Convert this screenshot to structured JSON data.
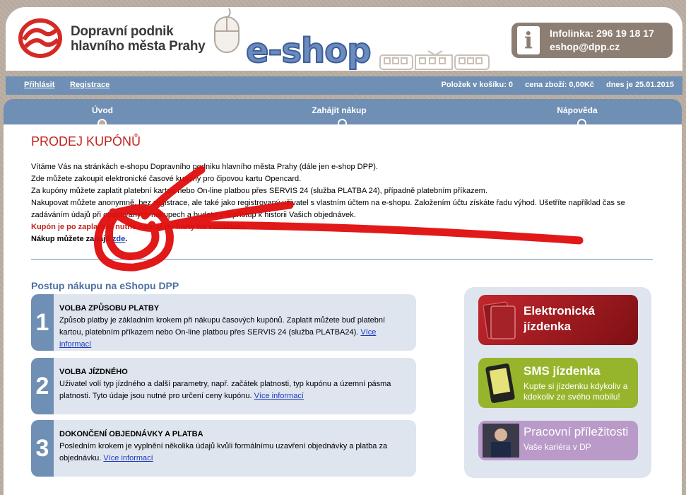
{
  "header": {
    "logo_line1": "Dopravní podnik",
    "logo_line2": "hlavního města Prahy",
    "eshop": "e-shop",
    "infolinka": "Infolinka: 296 19 18 17",
    "email": "eshop@dpp.cz",
    "info_icon": "i"
  },
  "userbar": {
    "login": "Přihlásit",
    "register": "Registrace",
    "cart_items": "Položek v košíku: 0",
    "cart_price": "cena zboží: 0,00Kč",
    "date": "dnes je 25.01.2015"
  },
  "nav": {
    "home": "Úvod",
    "start": "Zahájit nákup",
    "help": "Nápověda"
  },
  "content": {
    "title": "PRODEJ KUPÓNŮ",
    "p1": "Vítáme Vás na stránkách e-shopu Dopravního podniku hlavního města Prahy (dále jen e-shop DPP).",
    "p2": "Zde můžete zakoupit elektronické časové kupóny pro čipovou kartu Opencard.",
    "p3": "Za kupóny můžete zaplatit platební kartou nebo On-line platbou přes SERVIS 24 (služba PLATBA 24), případně platebním příkazem.",
    "p4": "Nakupovat můžete anonymně, bez registrace, ale také jako registrovaný uživatel s vlastním účtem na e-shopu. Založením účtu získáte řadu výhod. Ušetříte například čas se zadáváním údajů při opakovaných nákupech a budete mít přístup k historii Vašich objednávek.",
    "p5": "Kupón je po zaplacení nutné nahrát do karty na validátoru.",
    "p6_text": "Nákup můžete zahájit ",
    "p6_link": "zde",
    "p6_end": ".",
    "subtitle": "Postup nákupu na eShopu DPP"
  },
  "steps": [
    {
      "num": "1",
      "heading": "VOLBA ZPŮSOBU PLATBY",
      "text": "Způsob platby je základním krokem při nákupu časových kupónů. Zaplatit můžete buď platební kartou, platebním příkazem nebo On-line platbou přes SERVIS 24 (služba PLATBA24). ",
      "link": "Více informací"
    },
    {
      "num": "2",
      "heading": "VOLBA JÍZDNÉHO",
      "text": "Uživatel volí typ jízdného a další parametry, např. začátek platnosti, typ kupónu a územní pásma platnosti. Tyto údaje jsou nutné pro určení ceny kupónu. ",
      "link": "Více informací"
    },
    {
      "num": "3",
      "heading": "DOKONČENÍ OBJEDNÁVKY A PLATBA",
      "text": "Posledním krokem je vyplnění několika údajů kvůli formálnímu uzavření objednávky a platba za objednávku. ",
      "link": "Více informací"
    }
  ],
  "banners": {
    "electronic_1": "Elektronická",
    "electronic_2": "jízdenka",
    "sms_title": "SMS jízdenka",
    "sms_text1": "Kupte si jízdenku kdykoliv a",
    "sms_text2": "kdekoliv ze svého mobilu!",
    "jobs_title": "Pracovní příležitosti",
    "jobs_text": "Vaše kariéra v DP"
  },
  "colors": {
    "accent_blue": "#6f8fb4",
    "title_red": "#c0231d",
    "banner_red": "#a3161b",
    "banner_green": "#97b52c",
    "banner_purple": "#b99ac8"
  }
}
